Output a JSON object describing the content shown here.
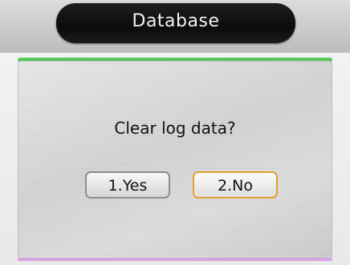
{
  "header": {
    "title": "Database"
  },
  "dialog": {
    "prompt": "Clear log data?",
    "buttons": [
      {
        "label": "1.Yes",
        "state": "normal"
      },
      {
        "label": "2.No",
        "state": "focused"
      }
    ]
  },
  "colors": {
    "title_bar": "#111111",
    "focus_border": "#e0a12a",
    "accent_top": "#56c85a",
    "accent_bottom": "#d7a3e0"
  }
}
